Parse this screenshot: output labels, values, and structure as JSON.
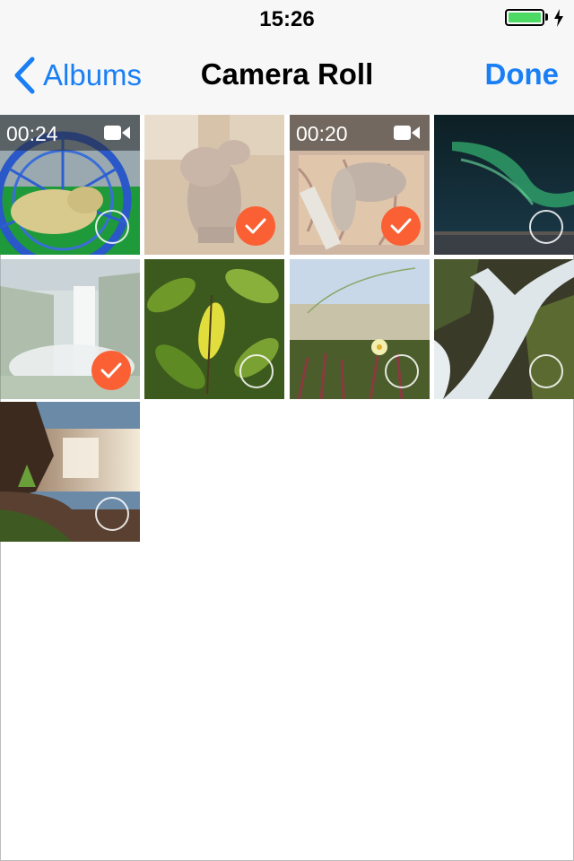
{
  "status_bar": {
    "time": "15:26",
    "battery_level": 1.0,
    "charging": true
  },
  "nav": {
    "back_label": "Albums",
    "title": "Camera Roll",
    "done_label": "Done"
  },
  "colors": {
    "accent": "#1a7ff5",
    "selected": "#fa6034"
  },
  "photos": [
    {
      "name": "hamster-video",
      "type": "video",
      "duration": "00:24",
      "selected": false
    },
    {
      "name": "hippo-figurine",
      "type": "photo",
      "selected": true
    },
    {
      "name": "cat-on-rug-video",
      "type": "video",
      "duration": "00:20",
      "selected": true
    },
    {
      "name": "northern-lights",
      "type": "photo",
      "selected": false
    },
    {
      "name": "waterfall-mist",
      "type": "photo",
      "selected": true
    },
    {
      "name": "green-leaves",
      "type": "photo",
      "selected": false
    },
    {
      "name": "beach-flower",
      "type": "photo",
      "selected": false
    },
    {
      "name": "waterfall-closeup",
      "type": "photo",
      "selected": false
    },
    {
      "name": "waterfall-sunset",
      "type": "photo",
      "selected": false
    }
  ]
}
